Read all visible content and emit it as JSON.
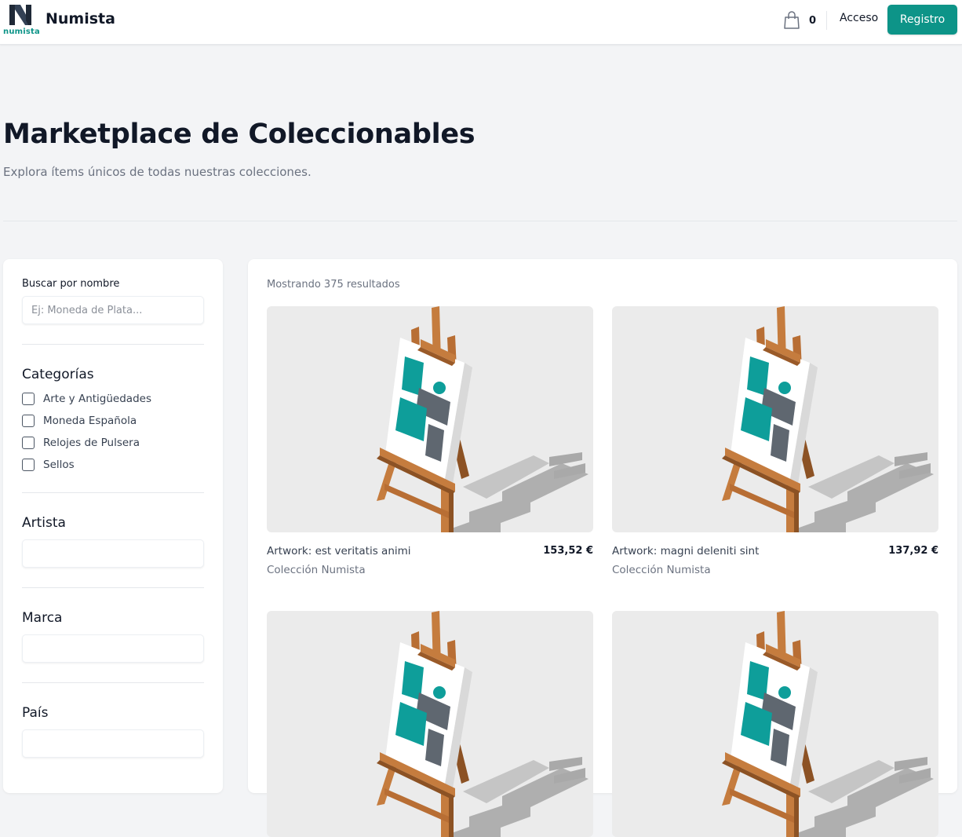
{
  "header": {
    "logo_text": "numista",
    "brand": "Numista",
    "cart_count": "0",
    "login_label": "Acceso",
    "register_label": "Registro"
  },
  "hero": {
    "title": "Marketplace de Coleccionables",
    "subtitle": "Explora ítems únicos de todas nuestras colecciones."
  },
  "filters": {
    "search_label": "Buscar por nombre",
    "search_placeholder": "Ej: Moneda de Plata...",
    "categories_title": "Categorías",
    "categories": [
      {
        "label": "Arte y Antigüedades",
        "checked": false
      },
      {
        "label": "Moneda Española",
        "checked": false
      },
      {
        "label": "Relojes de Pulsera",
        "checked": false
      },
      {
        "label": "Sellos",
        "checked": false
      }
    ],
    "artist_title": "Artista",
    "brand_title": "Marca",
    "country_title": "País"
  },
  "results": {
    "count_text": "Mostrando 375 resultados",
    "items": [
      {
        "name": "Artwork: est veritatis animi",
        "price": "153,52 €",
        "collection": "Colección Numista",
        "image_icon": "easel-icon"
      },
      {
        "name": "Artwork: magni deleniti sint",
        "price": "137,92 €",
        "collection": "Colección Numista",
        "image_icon": "easel-icon"
      },
      {
        "name": "",
        "price": "",
        "collection": "",
        "image_icon": "easel-icon"
      },
      {
        "name": "",
        "price": "",
        "collection": "",
        "image_icon": "easel-icon"
      }
    ]
  },
  "colors": {
    "accent": "#0d9488",
    "background": "#f3f4f6",
    "card_image_bg": "#ebebeb",
    "text_muted": "#6b7280"
  }
}
